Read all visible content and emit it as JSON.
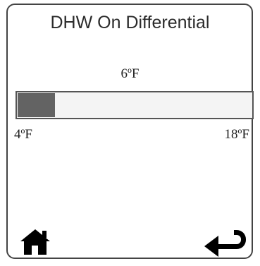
{
  "screen": {
    "title": "DHW On Differential"
  },
  "setting": {
    "current_label": "6ºF",
    "min_label": "4ºF",
    "max_label": "18ºF",
    "level_fraction": 0.16
  },
  "buttons": {
    "home_icon": "home-icon",
    "back_icon": "return-arrow-icon"
  },
  "colors": {
    "fill": "#636363",
    "track": "#f4f4f4",
    "border": "#444444"
  }
}
